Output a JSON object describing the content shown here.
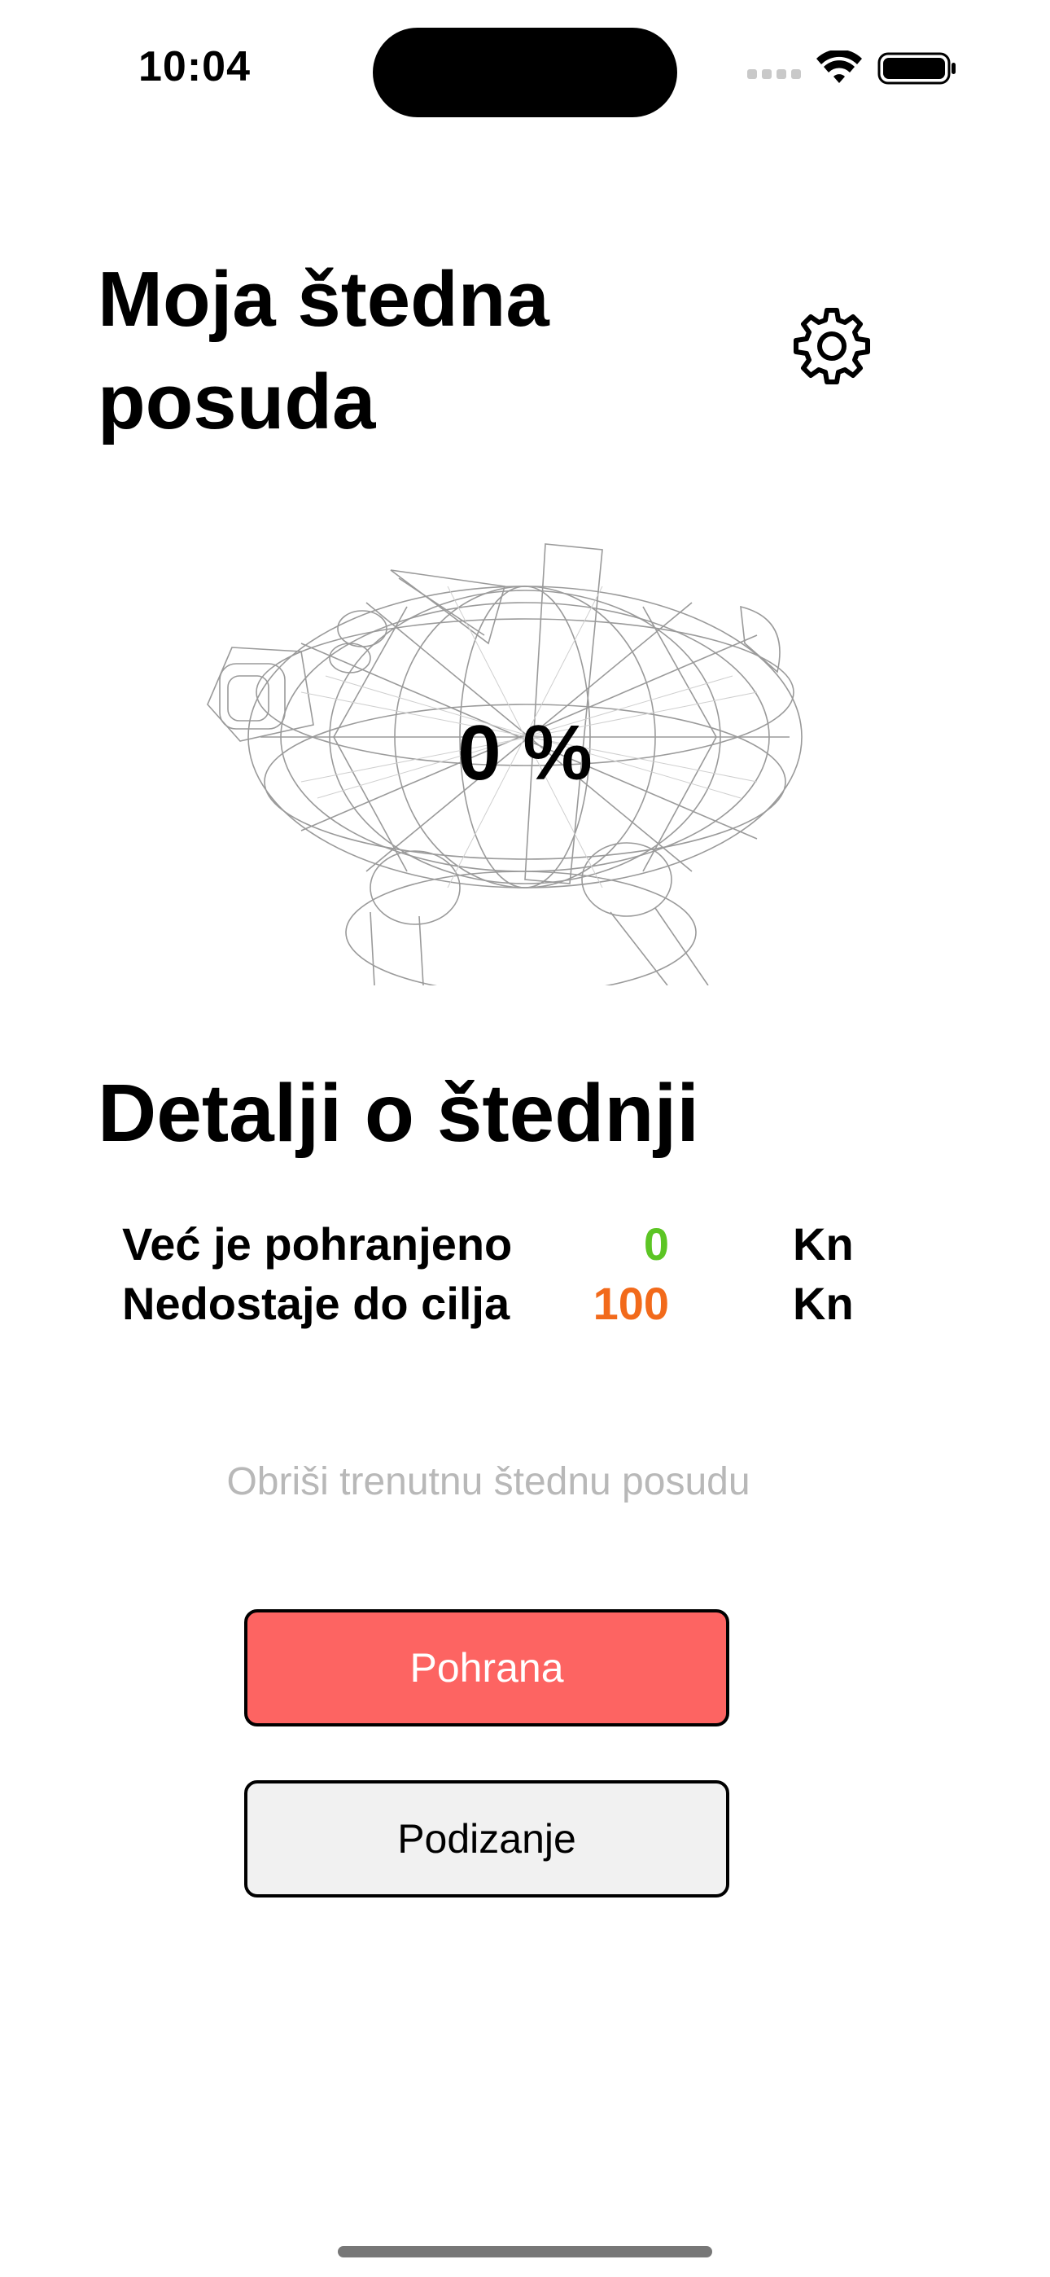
{
  "status_bar": {
    "time": "10:04"
  },
  "header": {
    "title": "Moja štedna posuda",
    "settings_icon": "gear-icon"
  },
  "piggy": {
    "progress_label": "0 %",
    "progress_fraction": 0
  },
  "details": {
    "title": "Detalji o štednji",
    "rows": [
      {
        "label": "Već je pohranjeno",
        "value": "0",
        "unit": "Kn",
        "color": "#5cc524"
      },
      {
        "label": "Nedostaje do cilja",
        "value": "100",
        "unit": "Kn",
        "color": "#f26a1b"
      }
    ]
  },
  "actions": {
    "delete_label": "Obriši trenutnu štednu posudu",
    "deposit_label": "Pohrana",
    "withdraw_label": "Podizanje"
  },
  "colors": {
    "deposit_bg": "#fd6462",
    "withdraw_bg": "#f1f1f1",
    "delete_text": "#b8b8b8"
  }
}
